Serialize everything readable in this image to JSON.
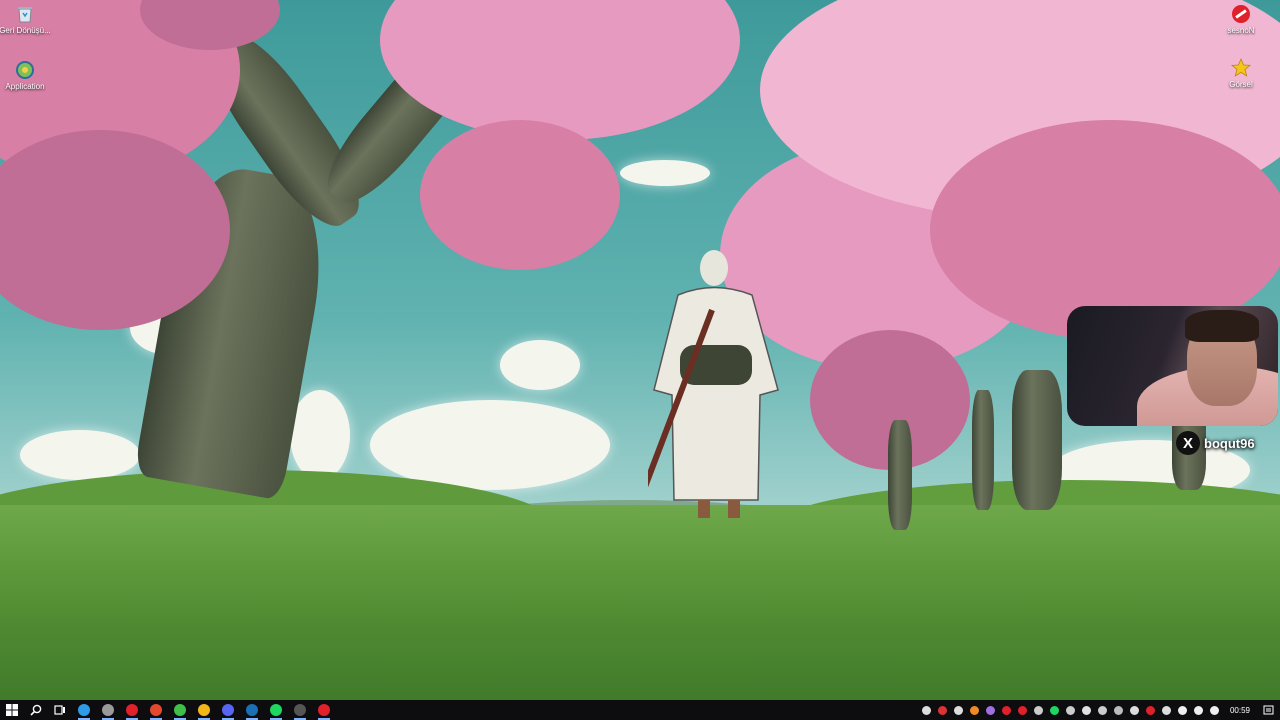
{
  "desktop": {
    "icons_left": [
      {
        "label": "Geri Dönüşü...",
        "icon": "recycle-bin-icon"
      },
      {
        "label": "Application",
        "icon": "application-icon"
      }
    ],
    "icons_right": [
      {
        "label": "sesnoN",
        "icon": "no-sign-icon"
      },
      {
        "label": "Görsel",
        "icon": "star-icon"
      }
    ]
  },
  "overlay": {
    "social_icon": "x-logo-icon",
    "social_glyph": "X",
    "handle": "boqut96"
  },
  "taskbar": {
    "pinned": [
      {
        "name": "start-button",
        "icon": "windows-logo-icon",
        "color": "#ffffff"
      },
      {
        "name": "search-button",
        "icon": "search-icon",
        "color": "#ffffff"
      },
      {
        "name": "task-view-button",
        "icon": "task-view-icon",
        "color": "#ffffff"
      },
      {
        "name": "edge-button",
        "icon": "edge-icon",
        "color": "#2f9be6"
      },
      {
        "name": "app-button-1",
        "icon": "circle-icon",
        "color": "#9a9a9a"
      },
      {
        "name": "opera-button",
        "icon": "opera-icon",
        "color": "#e0202a"
      },
      {
        "name": "app-button-2",
        "icon": "red-app-icon",
        "color": "#e2492d"
      },
      {
        "name": "app-button-3",
        "icon": "green-app-icon",
        "color": "#3fbf4a"
      },
      {
        "name": "chrome-button",
        "icon": "chrome-icon",
        "color": "#f2b718"
      },
      {
        "name": "discord-button",
        "icon": "discord-icon",
        "color": "#5865f2"
      },
      {
        "name": "steam-button",
        "icon": "steam-icon",
        "color": "#1b6fb3"
      },
      {
        "name": "spotify-button",
        "icon": "spotify-icon",
        "color": "#1ed760"
      },
      {
        "name": "app-button-4",
        "icon": "dark-app-icon",
        "color": "#555555"
      },
      {
        "name": "app-button-5",
        "icon": "record-icon",
        "color": "#e0202a"
      }
    ],
    "tray": [
      {
        "icon": "headset-icon",
        "color": "#dddddd"
      },
      {
        "icon": "shield-icon",
        "color": "#d33"
      },
      {
        "icon": "arrows-icon",
        "color": "#dddddd"
      },
      {
        "icon": "cloud-icon",
        "color": "#f08a24"
      },
      {
        "icon": "pen-icon",
        "color": "#a070e0"
      },
      {
        "icon": "red-icon",
        "color": "#e0202a"
      },
      {
        "icon": "red-square-icon",
        "color": "#e0202a"
      },
      {
        "icon": "gamepad-icon",
        "color": "#cccccc"
      },
      {
        "icon": "spotify-tray-icon",
        "color": "#1ed760"
      },
      {
        "icon": "app-tray-icon",
        "color": "#cccccc"
      },
      {
        "icon": "app-tray-icon-2",
        "color": "#e0e0e0"
      },
      {
        "icon": "steam-tray-icon",
        "color": "#cccccc"
      },
      {
        "icon": "app-tray-icon-3",
        "color": "#bbbbbb"
      },
      {
        "icon": "app-tray-icon-4",
        "color": "#dddddd"
      },
      {
        "icon": "red-tray-icon",
        "color": "#e0202a"
      },
      {
        "icon": "copy-icon",
        "color": "#dddddd"
      },
      {
        "icon": "mic-icon",
        "color": "#eeeeee"
      },
      {
        "icon": "network-icon",
        "color": "#eeeeee"
      },
      {
        "icon": "volume-icon",
        "color": "#eeeeee"
      }
    ],
    "clock": "00:59",
    "notification_icon": "notification-icon"
  }
}
